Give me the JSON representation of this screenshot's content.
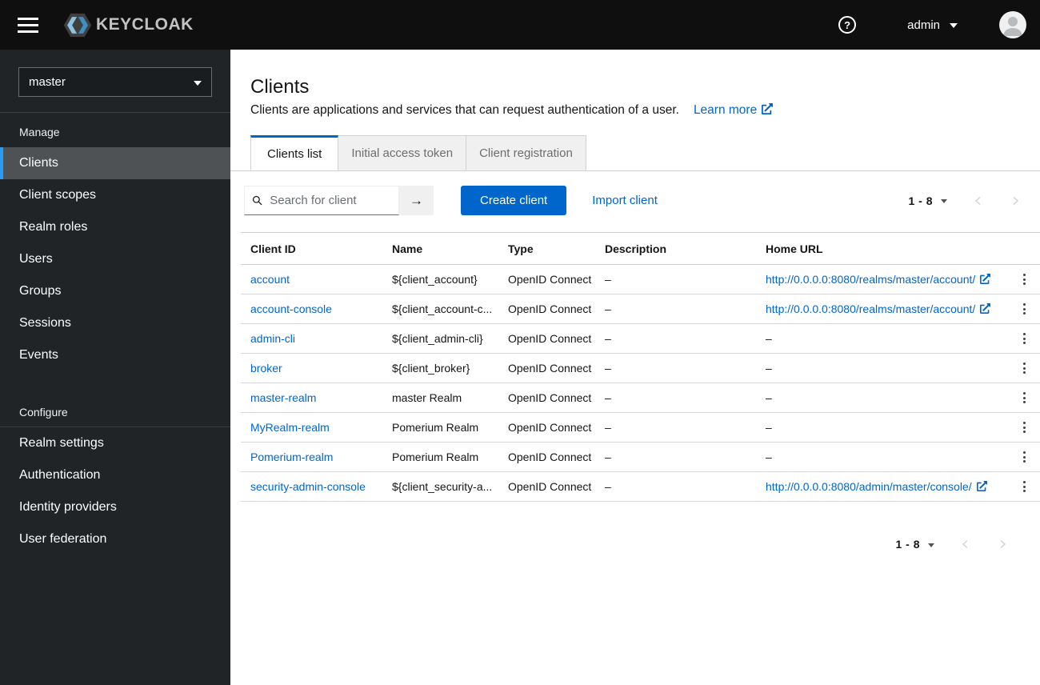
{
  "colors": {
    "primary_blue": "#0066cc",
    "link_blue": "#0066cc",
    "topbar_bg": "#0f0f0f",
    "sidebar_bg": "#212427",
    "sidebar_selected_bg": "#4f5255",
    "sidebar_selected_border": "#2b9af3",
    "inactive_tab_bg": "#f0f0f0",
    "border_light": "#d2d2d2",
    "text_dark": "#151515",
    "text_muted": "#6a6e73"
  },
  "icons": {
    "question": "?",
    "arrow_right": "→"
  },
  "topbar": {
    "brand": "KEYCLOAK",
    "user": "admin"
  },
  "sidebar": {
    "realm": "master",
    "sections": [
      {
        "label": "Manage",
        "items": [
          {
            "label": "Clients"
          },
          {
            "label": "Client scopes"
          },
          {
            "label": "Realm roles"
          },
          {
            "label": "Users"
          },
          {
            "label": "Groups"
          },
          {
            "label": "Sessions"
          },
          {
            "label": "Events"
          }
        ]
      },
      {
        "label": "Configure",
        "items": [
          {
            "label": "Realm settings"
          },
          {
            "label": "Authentication"
          },
          {
            "label": "Identity providers"
          },
          {
            "label": "User federation"
          }
        ]
      }
    ]
  },
  "page": {
    "title": "Clients",
    "description": "Clients are applications and services that can request authentication of a user.",
    "learn_more_label": "Learn more"
  },
  "tabs": [
    {
      "label": "Clients list"
    },
    {
      "label": "Initial access token"
    },
    {
      "label": "Client registration"
    }
  ],
  "toolbar": {
    "search_placeholder": "Search for client",
    "create_button_label": "Create client",
    "import_link_label": "Import client",
    "pagination_range": "1 - 8"
  },
  "table": {
    "columns": [
      "Client ID",
      "Name",
      "Type",
      "Description",
      "Home URL"
    ],
    "rows": [
      {
        "client_id": "account",
        "name": "${client_account}",
        "type": "OpenID Connect",
        "description": "–",
        "home_url": "http://0.0.0.0:8080/realms/master/account/"
      },
      {
        "client_id": "account-console",
        "name": "${client_account-c...",
        "type": "OpenID Connect",
        "description": "–",
        "home_url": "http://0.0.0.0:8080/realms/master/account/"
      },
      {
        "client_id": "admin-cli",
        "name": "${client_admin-cli}",
        "type": "OpenID Connect",
        "description": "–",
        "home_url": "–"
      },
      {
        "client_id": "broker",
        "name": "${client_broker}",
        "type": "OpenID Connect",
        "description": "–",
        "home_url": "–"
      },
      {
        "client_id": "master-realm",
        "name": "master Realm",
        "type": "OpenID Connect",
        "description": "–",
        "home_url": "–"
      },
      {
        "client_id": "MyRealm-realm",
        "name": "Pomerium Realm",
        "type": "OpenID Connect",
        "description": "–",
        "home_url": "–"
      },
      {
        "client_id": "Pomerium-realm",
        "name": "Pomerium Realm",
        "type": "OpenID Connect",
        "description": "–",
        "home_url": "–"
      },
      {
        "client_id": "security-admin-console",
        "name": "${client_security-a...",
        "type": "OpenID Connect",
        "description": "–",
        "home_url": "http://0.0.0.0:8080/admin/master/console/"
      }
    ]
  },
  "bottom_pagination": {
    "range": "1 - 8"
  }
}
